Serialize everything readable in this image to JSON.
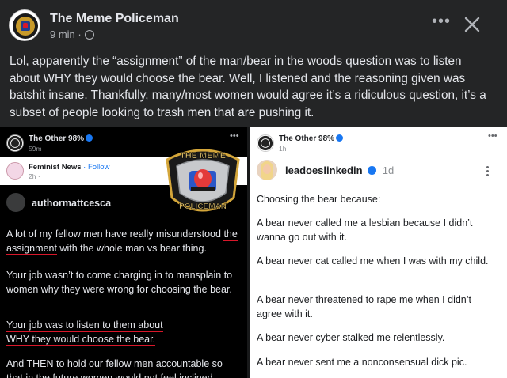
{
  "header": {
    "page_name": "The Meme Policeman",
    "time": "9 min ·",
    "more_label": "•••",
    "close_label": "✕"
  },
  "post": {
    "text": "Lol, apparently the “assignment” of the man/bear in the woods question was to listen about WHY they would choose the bear. Well, I listened and the reasoning given was batshit insane. Thankfully, many/most women would agree it’s a ridiculous question, it’s a subset of people looking to trash men that are pushing it."
  },
  "left_panel": {
    "page_name": "The Other 98%",
    "time": "59m ·",
    "more": "•••",
    "shared_page": "Feminist News",
    "follow": "· Follow",
    "shared_time": "2h ·",
    "author": "authormattcesca",
    "p1_a": "A lot of my fellow men have really misunderstood",
    "p1_b": "the assignment",
    "p1_c": " with the whole man vs bear thing.",
    "p2": "Your job wasn’t to come charging in to mansplain to women why they were wrong for choosing the bear.",
    "p3_a": "Your job was to listen to them about",
    "p3_b": "WHY they would choose the bear.",
    "p4": "And THEN to hold our fellow men accountable so that in the future women would not feel inclined"
  },
  "watermark": {
    "top": "THE MEME",
    "bottom": "POLICEMAN"
  },
  "right_panel": {
    "page_name": "The Other 98%",
    "time": "1h ·",
    "more": "•••",
    "author": "leadoeslinkedin",
    "author_time": "1d",
    "lines": [
      "Choosing the bear because:",
      "A bear never called me a lesbian because I didn’t wanna go out with it.",
      "A bear never cat called me when I was with my child.",
      "A bear never threatened to rape me when I didn’t agree with it.",
      "A bear never cyber stalked me relentlessly.",
      "A bear never sent me a nonconsensual dick pic."
    ]
  },
  "colors": {
    "bg": "#242526",
    "text": "#e4e6eb",
    "muted": "#b0b3b8",
    "underline_red": "#d8172a",
    "verified_blue": "#1877f2"
  }
}
